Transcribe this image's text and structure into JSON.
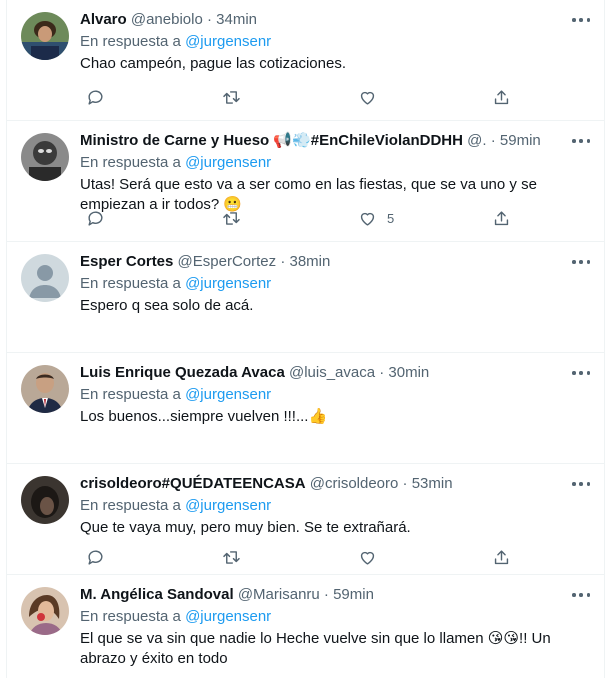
{
  "reply_prefix": "En respuesta a",
  "tweets": [
    {
      "name": "Alvaro",
      "handle": "@anebiolo",
      "sep": "·",
      "time": "34min",
      "reply_to": "@jurgensenr",
      "text": "Chao campeón, pague las cotizaciones.",
      "likes": "",
      "avatar_color": "#3a5a3a"
    },
    {
      "name": "Ministro de Carne y Hueso 📢💨#EnChileViolanDDHH",
      "handle": "@.",
      "sep": "·",
      "time": "59min",
      "reply_to": "@jurgensenr",
      "text": "Utas! Será que esto va a ser como en las fiestas, que se va uno y se empiezan a ir todos? 😬",
      "likes": "5",
      "avatar_color": "#4a4a4a"
    },
    {
      "name": "Esper Cortes",
      "handle": "@EsperCortez",
      "sep": "·",
      "time": "38min",
      "reply_to": "@jurgensenr",
      "text": "Espero q sea solo de acá.",
      "likes": "",
      "avatar_color": "#cfd9de"
    },
    {
      "name": "Luis Enrique Quezada Avaca",
      "handle": "@luis_avaca",
      "sep": "·",
      "time": "30min",
      "reply_to": "@jurgensenr",
      "text": "Los buenos...siempre vuelven !!!...👍",
      "likes": "",
      "avatar_color": "#8b7a6a"
    },
    {
      "name": "crisoldeoro#QUÉDATEENCASA",
      "handle": "@crisoldeoro",
      "sep": "·",
      "time": "53min",
      "reply_to": "@jurgensenr",
      "text": "Que te vaya muy, pero muy bien.  Se te extrañará.",
      "likes": "",
      "avatar_color": "#2a2622"
    },
    {
      "name": "M. Angélica Sandoval",
      "handle": "@Marisanru",
      "sep": "·",
      "time": "59min",
      "reply_to": "@jurgensenr",
      "text": "El que se va sin que nadie lo Heche vuelve sin que lo llamen 😘😘!! Un abrazo y éxito en todo",
      "likes": "",
      "avatar_color": "#c9a58a"
    }
  ]
}
